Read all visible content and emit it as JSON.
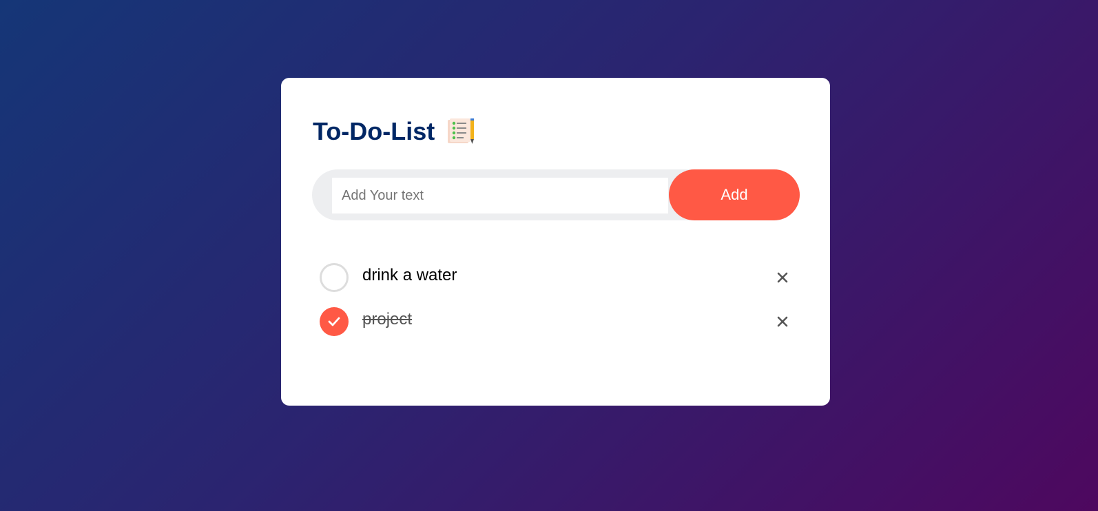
{
  "app": {
    "title": "To-Do-List",
    "title_icon": "notepad-checklist-pencil-icon"
  },
  "input": {
    "placeholder": "Add Your text",
    "value": ""
  },
  "add_button": {
    "label": "Add"
  },
  "tasks": [
    {
      "text": "drink a water",
      "checked": false
    },
    {
      "text": "project",
      "checked": true
    }
  ],
  "colors": {
    "accent": "#ff5945",
    "title": "#002765",
    "input_row_bg": "#edeef0",
    "gradient_start": "#153677",
    "gradient_end": "#4e085f"
  }
}
